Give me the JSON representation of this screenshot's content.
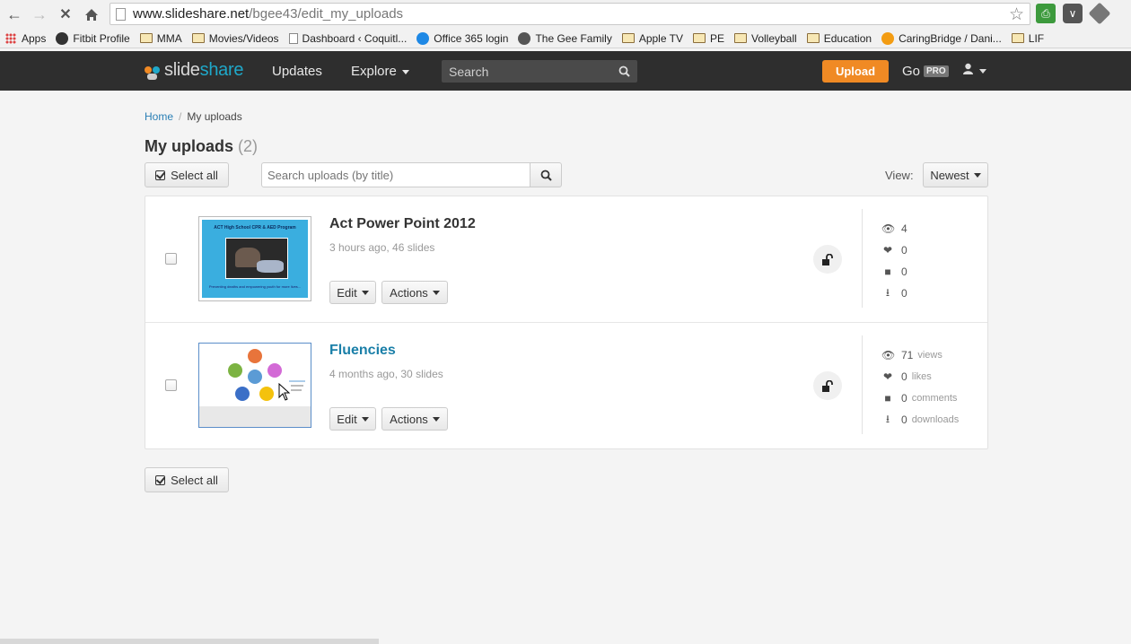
{
  "browser": {
    "url_host": "www.slideshare.net",
    "url_path": "/bgee43/edit_my_uploads",
    "bookmarks": [
      {
        "label": "Apps",
        "icon": "apps-icon"
      },
      {
        "label": "Fitbit Profile",
        "icon": "fitbit-icon"
      },
      {
        "label": "MMA",
        "icon": "folder-icon"
      },
      {
        "label": "Movies/Videos",
        "icon": "folder-icon"
      },
      {
        "label": "Dashboard ‹ Coquitl...",
        "icon": "page-icon"
      },
      {
        "label": "Office 365 login",
        "icon": "office-icon"
      },
      {
        "label": "The Gee Family",
        "icon": "wordpress-icon"
      },
      {
        "label": "Apple TV",
        "icon": "folder-icon"
      },
      {
        "label": "PE",
        "icon": "folder-icon"
      },
      {
        "label": "Volleyball",
        "icon": "folder-icon"
      },
      {
        "label": "Education",
        "icon": "folder-icon"
      },
      {
        "label": "CaringBridge / Dani...",
        "icon": "caringbridge-icon"
      },
      {
        "label": "LIF",
        "icon": "folder-icon"
      }
    ]
  },
  "header": {
    "logo_slide": "slide",
    "logo_share": "share",
    "updates": "Updates",
    "explore": "Explore",
    "search_placeholder": "Search",
    "upload": "Upload",
    "go": "Go",
    "pro": "PRO"
  },
  "breadcrumb": {
    "home": "Home",
    "separator": "/",
    "current": "My uploads"
  },
  "page": {
    "title": "My uploads",
    "count": "(2)",
    "select_all": "Select all",
    "search_placeholder": "Search uploads (by title)",
    "view_label": "View:",
    "sort_value": "Newest"
  },
  "uploads": [
    {
      "title": "Act Power Point 2012",
      "meta": "3 hours ago, 46 slides",
      "edit": "Edit",
      "actions": "Actions",
      "thumb_caption": "ACT High School CPR & AED Program",
      "thumb_footer": "Preventing deaths and empowering youth for more lives...",
      "stats": {
        "views": "4",
        "likes": "0",
        "comments": "0",
        "downloads": "0"
      },
      "stat_labels": {
        "views": "",
        "likes": "",
        "comments": "",
        "downloads": ""
      }
    },
    {
      "title": "Fluencies",
      "meta": "4 months ago, 30 slides",
      "edit": "Edit",
      "actions": "Actions",
      "stats": {
        "views": "71",
        "likes": "0",
        "comments": "0",
        "downloads": "0"
      },
      "stat_labels": {
        "views": "views",
        "likes": "likes",
        "comments": "comments",
        "downloads": "downloads"
      }
    }
  ],
  "footer": {
    "select_all": "Select all"
  },
  "colors": {
    "accent": "#f08a24",
    "brand": "#1fa8c9",
    "link": "#1a7fa8",
    "header": "#2e2e2e"
  }
}
